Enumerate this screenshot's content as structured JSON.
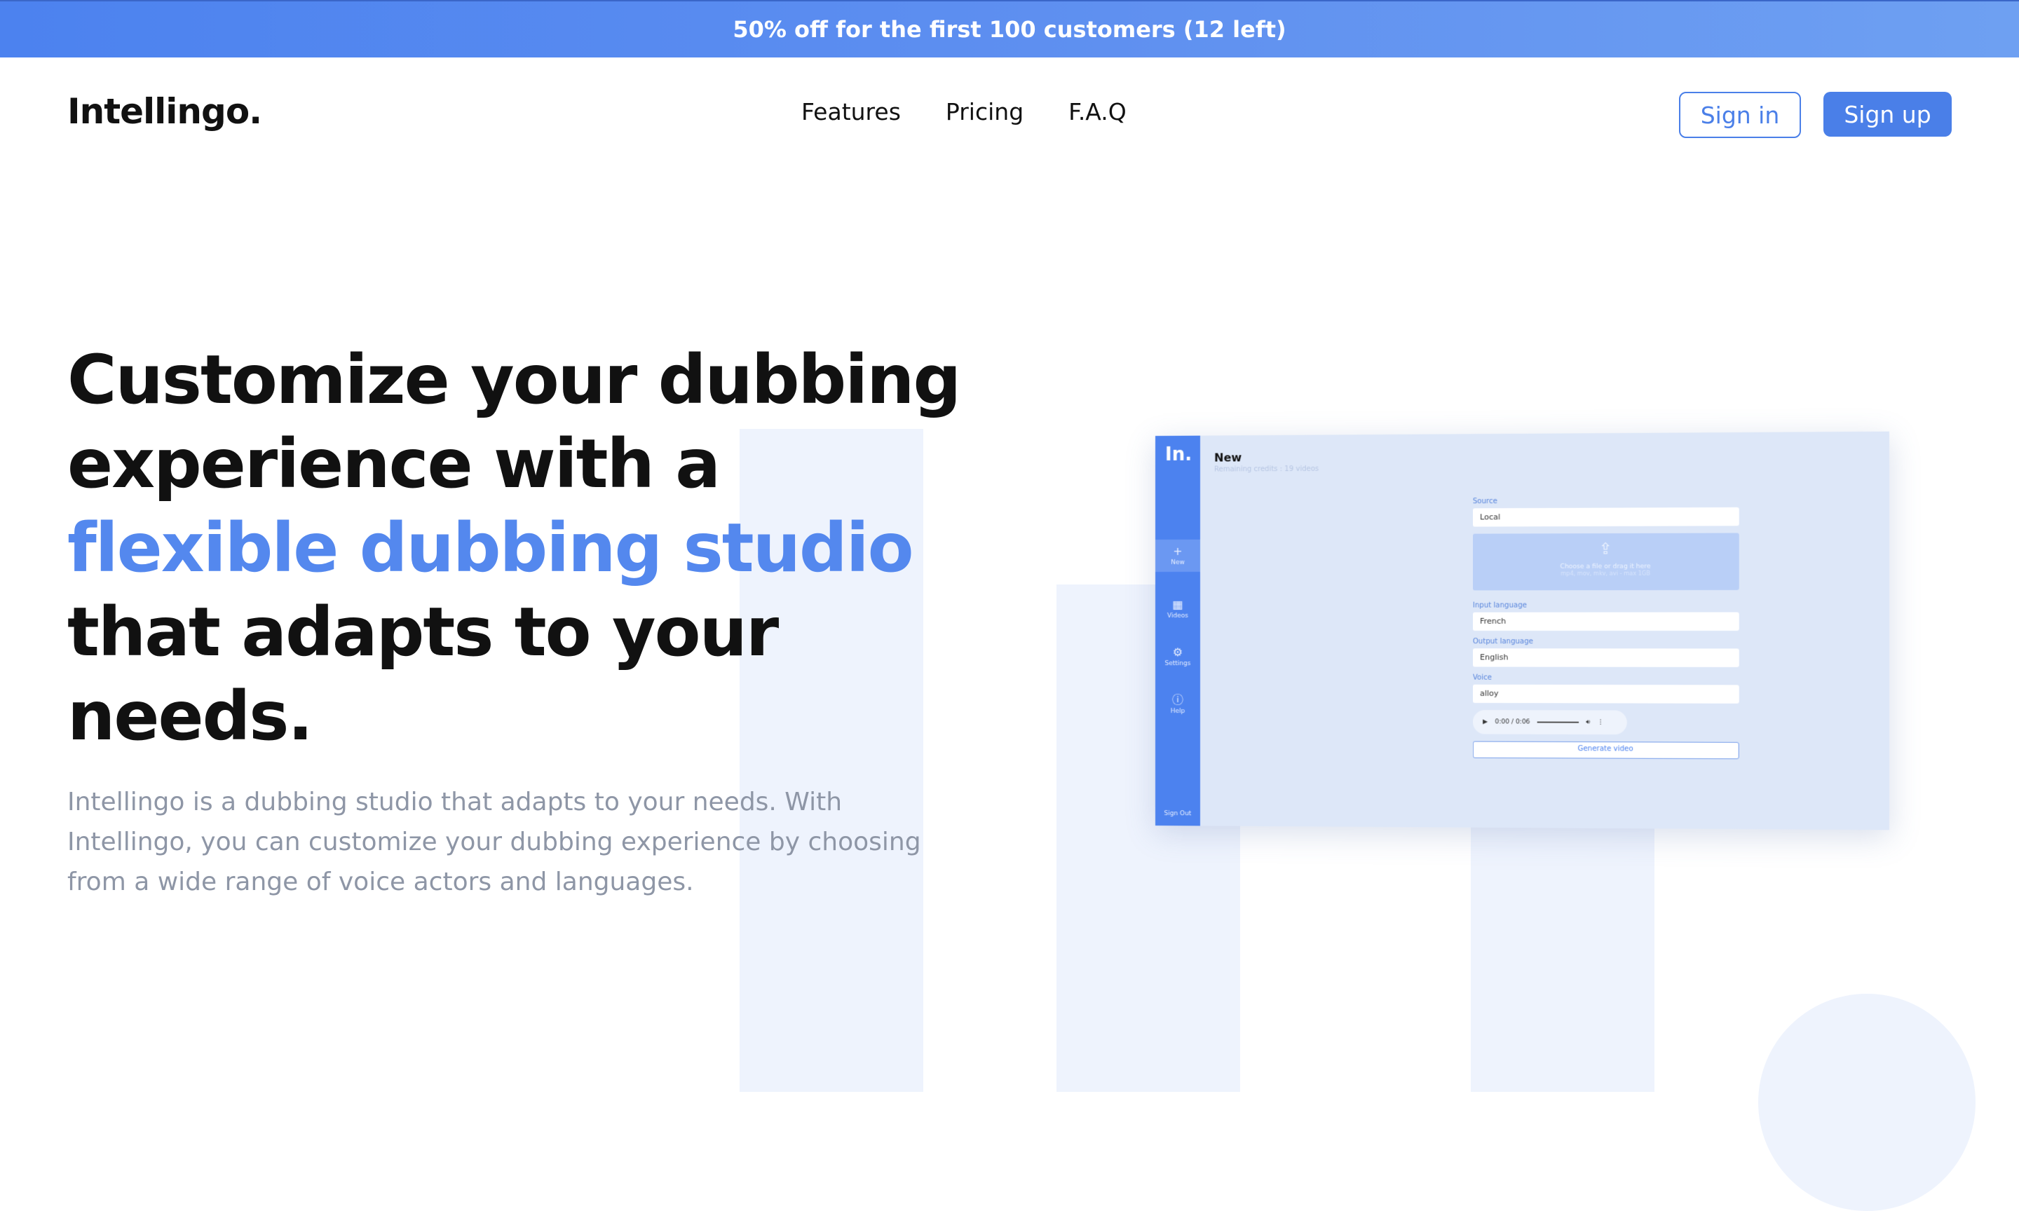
{
  "promo": {
    "text": "50% off for the first 100 customers (12 left)"
  },
  "header": {
    "logo": "Intellingo.",
    "nav": [
      "Features",
      "Pricing",
      "F.A.Q"
    ],
    "signin_label": "Sign in",
    "signup_label": "Sign up"
  },
  "hero": {
    "line1": "Customize your dubbing experience with a ",
    "accent": "flexible dubbing studio",
    "line2": " that adapts to your needs.",
    "description": "Intellingo is a dubbing studio that adapts to your needs. With Intellingo, you can customize your dubbing experience by choosing from a wide range of voice actors and languages."
  },
  "mockup": {
    "logo": "In.",
    "nav": [
      {
        "icon": "plus-icon",
        "glyph": "+",
        "label": "New"
      },
      {
        "icon": "film-icon",
        "glyph": "▦",
        "label": "Videos"
      },
      {
        "icon": "gear-icon",
        "glyph": "⚙",
        "label": "Settings"
      },
      {
        "icon": "info-icon",
        "glyph": "ⓘ",
        "label": "Help"
      }
    ],
    "signout": "Sign Out",
    "title": "New",
    "subtitle": "Remaining credits : 19 videos",
    "source_label": "Source",
    "source_value": "Local",
    "drop_text": "Choose a file or drag it here",
    "drop_hint": "mp4, mov, mkv, avi - max 1GB",
    "input_language_label": "Input language",
    "input_language_value": "French",
    "output_language_label": "Output language",
    "output_language_value": "English",
    "voice_label": "Voice",
    "voice_value": "alloy",
    "audio_time": "0:00 / 0:06",
    "generate_label": "Generate video"
  },
  "colors": {
    "accent": "#4a7fe8",
    "hero_accent": "#5488ee",
    "muted_text": "#8e96a6",
    "shape_bg": "#eef3fd"
  }
}
